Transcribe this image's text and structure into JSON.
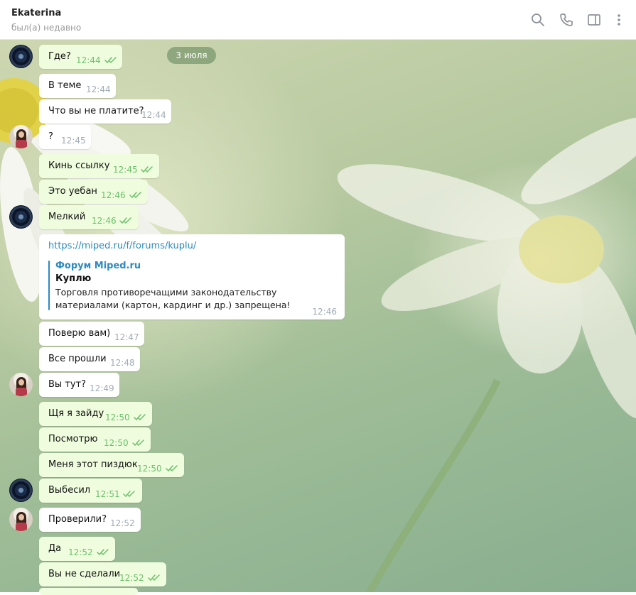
{
  "header": {
    "title": "Ekaterina",
    "status": "был(а) недавно",
    "icons": [
      "search-icon",
      "phone-icon",
      "sidebar-toggle-icon",
      "more-vertical-icon"
    ]
  },
  "colors": {
    "incoming_bubble": "#ffffff",
    "outgoing_bubble": "#effdde",
    "outgoing_time": "#6cbf6c",
    "link": "#2c8ac4"
  },
  "date_divider": "3 июля",
  "messages": [
    {
      "text": "Где?",
      "time": "12:44",
      "outgoing": true
    },
    {
      "text": "В теме",
      "time": "12:44",
      "outgoing": false
    },
    {
      "text": "Что вы не платите?",
      "time": "12:44",
      "outgoing": false
    },
    {
      "text": "?",
      "time": "12:45",
      "outgoing": false
    },
    {
      "text": "Кинь ссылку",
      "time": "12:45",
      "outgoing": true
    },
    {
      "text": "Это уебан",
      "time": "12:46",
      "outgoing": true
    },
    {
      "text": "Мелкий",
      "time": "12:46",
      "outgoing": true
    },
    {
      "text": "Поверю вам)",
      "time": "12:47",
      "outgoing": false
    },
    {
      "text": "Все прошли",
      "time": "12:48",
      "outgoing": false
    },
    {
      "text": "Вы тут?",
      "time": "12:49",
      "outgoing": false
    },
    {
      "text": "Щя я зайду",
      "time": "12:50",
      "outgoing": true
    },
    {
      "text": "Посмотрю",
      "time": "12:50",
      "outgoing": true
    },
    {
      "text": "Меня этот пиздюк",
      "time": "12:50",
      "outgoing": true
    },
    {
      "text": "Выбесил",
      "time": "12:51",
      "outgoing": true
    },
    {
      "text": "Проверили?",
      "time": "12:52",
      "outgoing": false
    },
    {
      "text": "Да",
      "time": "12:52",
      "outgoing": true
    },
    {
      "text": "Вы не сделали",
      "time": "12:52",
      "outgoing": true
    }
  ],
  "link_message": {
    "url": "https://miped.ru/f/forums/kuplu/",
    "site_name": "Форум Miped.ru",
    "title": "Куплю",
    "description": "Торговля противоречащими законодательству материалами (картон, кардинг и др.) запрещена!",
    "time": "12:46"
  }
}
